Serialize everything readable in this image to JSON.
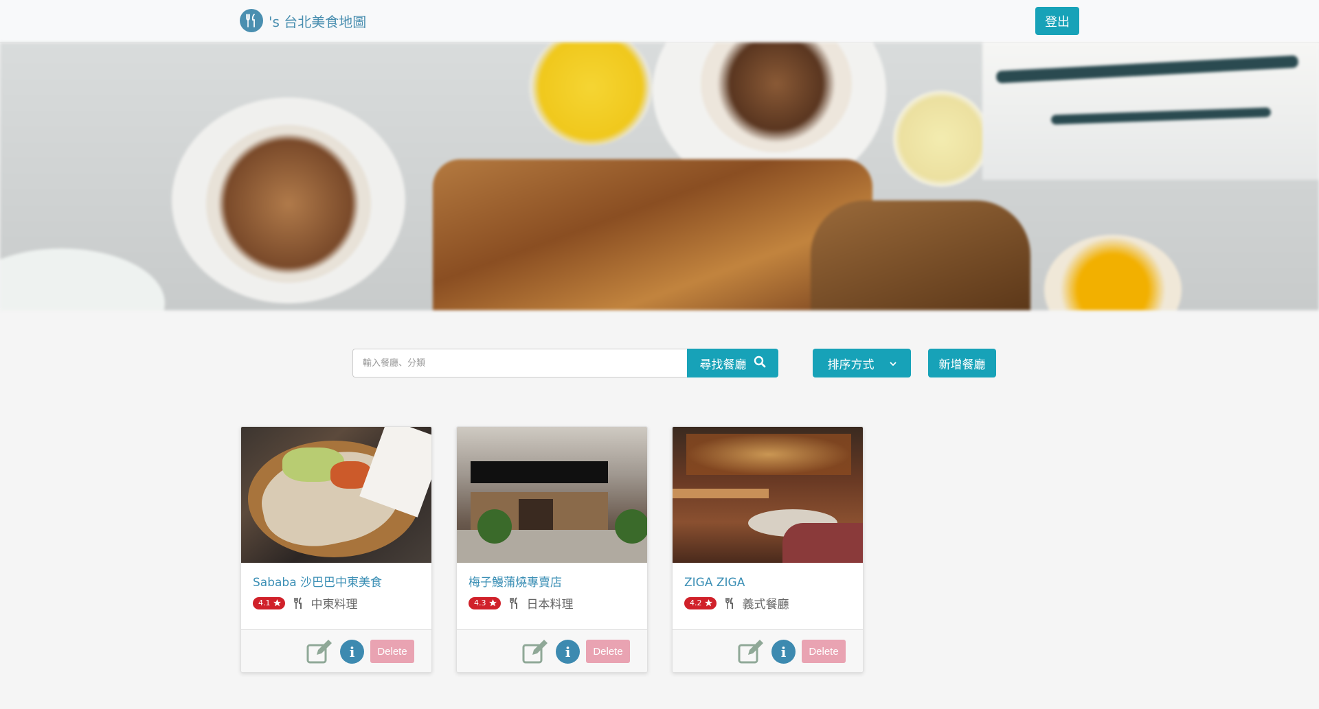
{
  "navbar": {
    "brand_text": "'s 台北美食地圖",
    "logout_label": "登出"
  },
  "search": {
    "placeholder": "輸入餐廳、分類",
    "button_label": "尋找餐廳"
  },
  "sort": {
    "label": "排序方式"
  },
  "add": {
    "label": "新增餐廳"
  },
  "restaurants": [
    {
      "name": "Sababa 沙巴巴中東美食",
      "rating": "4.1",
      "category": "中東料理",
      "delete_label": "Delete"
    },
    {
      "name": "梅子鰻蒲燒專賣店",
      "rating": "4.3",
      "category": "日本料理",
      "delete_label": "Delete"
    },
    {
      "name": "ZIGA ZIGA",
      "rating": "4.2",
      "category": "義式餐廳",
      "delete_label": "Delete"
    }
  ],
  "colors": {
    "primary": "#17a2b8",
    "link": "#3b8fb5",
    "rating": "#d0212a",
    "delete": "#e9a3b2",
    "info": "#3d8ab0"
  }
}
